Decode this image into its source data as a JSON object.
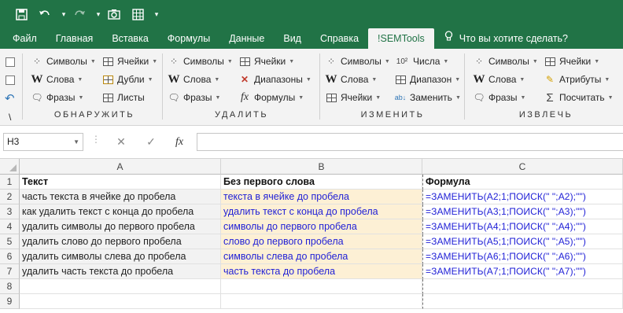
{
  "colors": {
    "brand": "#217346",
    "ribbon_bg": "#f3f3f3",
    "cell_gray": "#f2f2f2",
    "cell_peach": "#fdf0d5",
    "link_blue": "#1f1fd6"
  },
  "quick_access": {
    "save_icon": "save-icon",
    "undo_icon": "undo-icon",
    "redo_icon": "redo-icon",
    "camera_icon": "camera-icon",
    "table_icon": "table-icon"
  },
  "tabs": [
    "Файл",
    "Главная",
    "Вставка",
    "Формулы",
    "Данные",
    "Вид",
    "Справка",
    "!SEMTools"
  ],
  "tell_me": "Что вы хотите сделать?",
  "ribbon": {
    "groups": [
      {
        "label": "ОБНАРУЖИТЬ",
        "items": {
          "symbols": "Символы",
          "words": "Слова",
          "phrases": "Фразы",
          "cells": "Ячейки",
          "dups": "Дубли",
          "sheets": "Листы"
        }
      },
      {
        "label": "УДАЛИТЬ",
        "items": {
          "symbols": "Символы",
          "words": "Слова",
          "phrases": "Фразы",
          "cells": "Ячейки",
          "ranges": "Диапазоны",
          "formulas": "Формулы"
        }
      },
      {
        "label": "ИЗМЕНИТЬ",
        "items": {
          "symbols": "Символы",
          "words": "Слова",
          "cells": "Ячейки",
          "numbers": "Числа",
          "numbers_icon": "10²",
          "range": "Диапазон",
          "replace": "Заменить"
        }
      },
      {
        "label": "ИЗВЛЕЧЬ",
        "items": {
          "symbols": "Символы",
          "words": "Слова",
          "phrases": "Фразы",
          "cells": "Ячейки",
          "attributes": "Атрибуты",
          "count": "Посчитать"
        }
      }
    ],
    "left_strip": {
      "backslash": "\\"
    }
  },
  "formula_bar": {
    "name_box": "H3",
    "cancel": "✕",
    "confirm": "✓",
    "fx": "fx",
    "formula": ""
  },
  "sheet": {
    "columns": [
      "A",
      "B",
      "C"
    ],
    "rows": [
      "1",
      "2",
      "3",
      "4",
      "5",
      "6",
      "7",
      "8",
      "9"
    ],
    "header": {
      "a": "Текст",
      "b": "Без первого слова",
      "c": "Формула"
    },
    "data": [
      {
        "a": "часть текста в ячейке до пробела",
        "b": "текста в ячейке до пробела",
        "c": "=ЗАМЕНИТЬ(A2;1;ПОИСК(\" \";A2);\"\")"
      },
      {
        "a": "как удалить текст с конца до пробела",
        "b": "удалить текст с конца до пробела",
        "c": "=ЗАМЕНИТЬ(A3;1;ПОИСК(\" \";A3);\"\")"
      },
      {
        "a": "удалить символы до первого пробела",
        "b": "символы до первого пробела",
        "c": "=ЗАМЕНИТЬ(A4;1;ПОИСК(\" \";A4);\"\")"
      },
      {
        "a": "удалить слово до первого пробела",
        "b": "слово до первого пробела",
        "c": "=ЗАМЕНИТЬ(A5;1;ПОИСК(\" \";A5);\"\")"
      },
      {
        "a": "удалить символы слева до пробела",
        "b": "символы слева до пробела",
        "c": "=ЗАМЕНИТЬ(A6;1;ПОИСК(\" \";A6);\"\")"
      },
      {
        "a": "удалить часть текста до пробела",
        "b": "часть текста до пробела",
        "c": "=ЗАМЕНИТЬ(A7;1;ПОИСК(\" \";A7);\"\")"
      }
    ]
  }
}
